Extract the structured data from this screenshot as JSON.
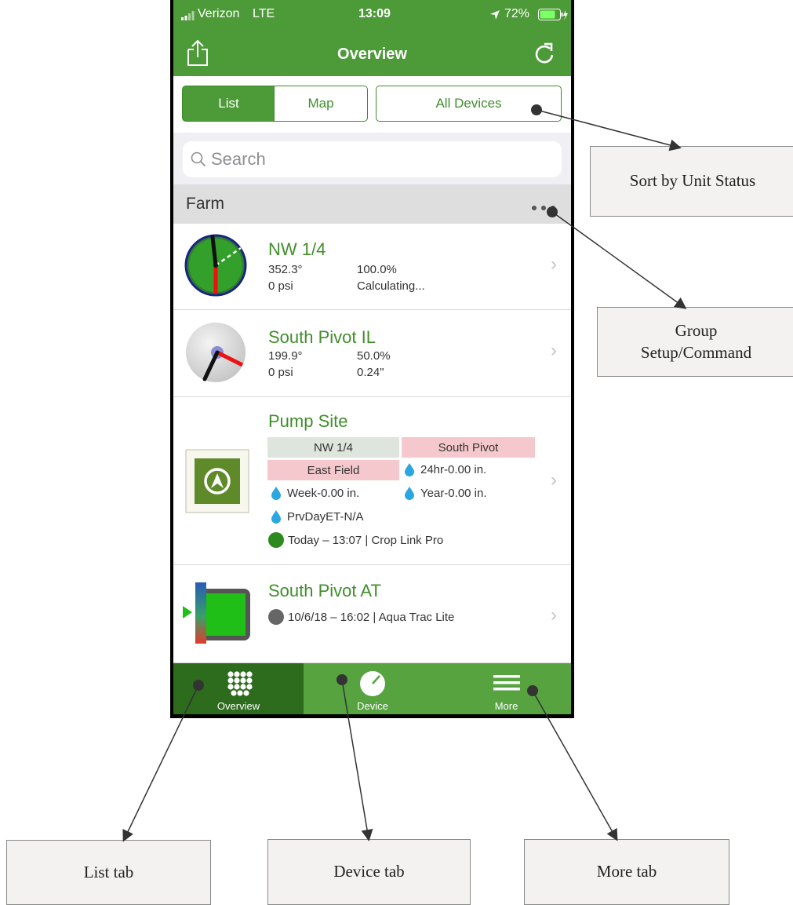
{
  "status_bar": {
    "carrier": "Verizon",
    "network": "LTE",
    "time": "13:09",
    "battery": "72%"
  },
  "nav": {
    "title": "Overview",
    "share_icon": "share-icon",
    "refresh_icon": "refresh-icon"
  },
  "segments": {
    "list": "List",
    "map": "Map",
    "filter": "All Devices"
  },
  "search": {
    "placeholder": "Search"
  },
  "group": {
    "name": "Farm",
    "more_icon": "ellipsis-icon"
  },
  "devices": [
    {
      "name": "NW 1/4",
      "angle": "352.3°",
      "percent": "100.0%",
      "pressure": "0 psi",
      "status": "Calculating..."
    },
    {
      "name": "South Pivot IL",
      "angle": "199.9°",
      "percent": "50.0%",
      "pressure": "0 psi",
      "status": "0.24\""
    },
    {
      "name": "Pump Site",
      "cells": [
        "NW 1/4",
        "South Pivot",
        "East Field"
      ],
      "rain_24hr": "24hr-0.00 in.",
      "rain_week": "Week-0.00 in.",
      "rain_year": "Year-0.00 in.",
      "prev_et": "PrvDayET-N/A",
      "last_update": "Today – 13:07 | Crop Link Pro"
    },
    {
      "name": "South Pivot AT",
      "last_update": "10/6/18 – 16:02 | Aqua Trac Lite"
    }
  ],
  "tabs": {
    "overview": "Overview",
    "device": "Device",
    "more": "More"
  },
  "annotations": {
    "sort": "Sort by Unit Status",
    "group_setup_line1": "Group",
    "group_setup_line2": "Setup/Command",
    "list_tab": "List tab",
    "device_tab": "Device tab",
    "more_tab": "More tab"
  },
  "colors": {
    "brand_green": "#4d9a38",
    "title_green": "#3f8f2b",
    "tab_selected": "#2d6b1d",
    "alert_pink": "#f4c8cc",
    "neutral_cell": "#dde5dd",
    "drop_blue": "#2aa6e0"
  }
}
